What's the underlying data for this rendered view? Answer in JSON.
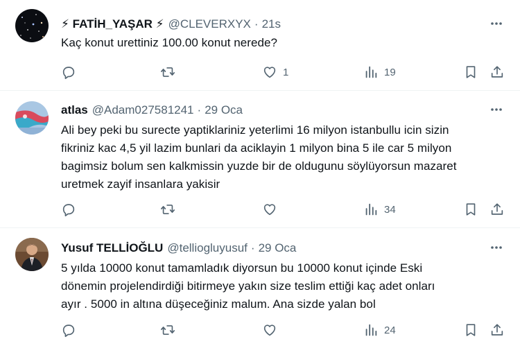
{
  "tweets": [
    {
      "display_name": "⚡ FATİH_YAŞAR ⚡",
      "handle": "@CLEVERXYX",
      "dot": "·",
      "time": "21s",
      "lines": [
        "Kaç konut urettiniz 100.00 konut nerede?"
      ],
      "reply_count": "",
      "retweet_count": "",
      "like_count": "1",
      "view_count": "19",
      "avatar": "starry-space-photo"
    },
    {
      "display_name": "atlas",
      "handle": "@Adam027581241",
      "dot": "·",
      "time": "29 Oca",
      "lines": [
        "Ali bey peki bu surecte yaptiklariniz yeterlimi 16 milyon istanbullu icin sizin",
        "fikriniz kac 4,5 yil lazim bunlari da aciklayin 1 milyon bina 5 ile car 5 milyon",
        "bagimsiz bolum sen kalkmissin yuzde bir de oldugunu söylüyorsun mazaret",
        "uretmek zayif insanlara yakisir"
      ],
      "reply_count": "",
      "retweet_count": "",
      "like_count": "",
      "view_count": "34",
      "avatar": "flag-photo"
    },
    {
      "display_name": "Yusuf TELLİOĞLU",
      "handle": "@telliogluyusuf",
      "dot": "·",
      "time": "29 Oca",
      "lines": [
        "5 yılda 10000 konut tamamladık diyorsun bu 10000 konut içinde Eski",
        "dönemin projelendirdiği bitirmeye yakın size teslim ettiği kaç adet onları",
        "ayır . 5000 in altına düşeceğiniz malum. Ana sizde yalan bol"
      ],
      "reply_count": "",
      "retweet_count": "",
      "like_count": "",
      "view_count": "24",
      "avatar": "man-in-suit-photo"
    }
  ],
  "colors": {
    "text": "#0f1419",
    "secondary": "#536471",
    "divider": "#eff3f4"
  },
  "icons": [
    "more-icon",
    "reply-icon",
    "retweet-icon",
    "like-icon",
    "views-icon",
    "bookmark-icon",
    "share-icon"
  ]
}
